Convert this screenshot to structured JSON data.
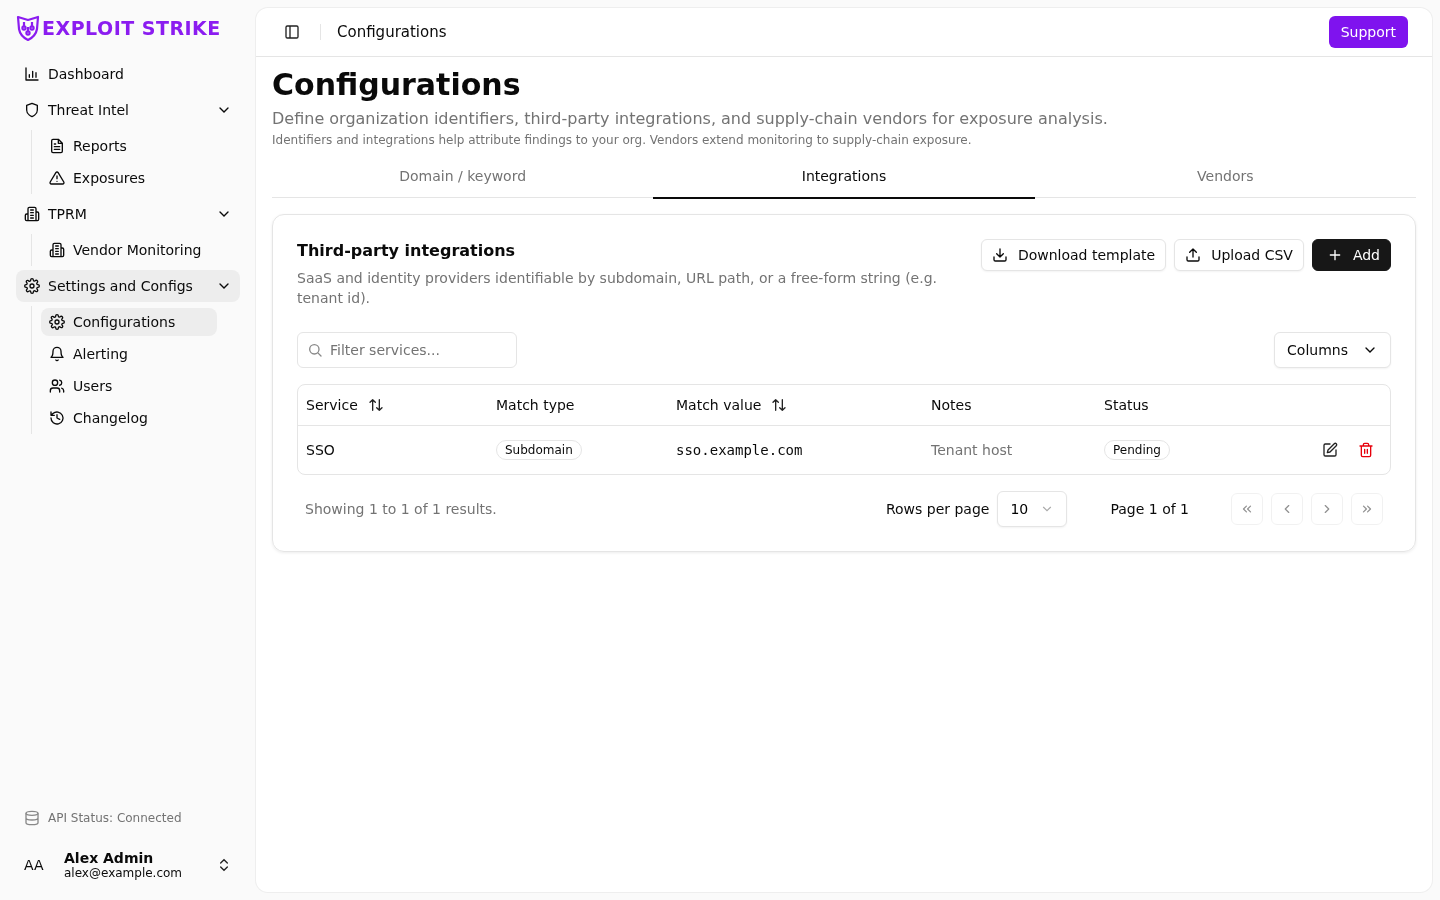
{
  "brand": {
    "name": "EXPLOIT STRIKE"
  },
  "sidebar": {
    "items": [
      {
        "label": "Dashboard",
        "selected": false
      },
      {
        "label": "Threat Intel",
        "selected": false,
        "expanded": true,
        "children": [
          {
            "label": "Reports",
            "selected": false
          },
          {
            "label": "Exposures",
            "selected": false
          }
        ]
      },
      {
        "label": "TPRM",
        "selected": false,
        "expanded": true,
        "children": [
          {
            "label": "Vendor Monitoring",
            "selected": false
          }
        ]
      },
      {
        "label": "Settings and Configs",
        "selected": true,
        "expanded": true,
        "children": [
          {
            "label": "Configurations",
            "selected": true
          },
          {
            "label": "Alerting",
            "selected": false
          },
          {
            "label": "Users",
            "selected": false
          },
          {
            "label": "Changelog",
            "selected": false
          }
        ]
      }
    ],
    "api_status": "API Status: Connected",
    "user": {
      "initials": "AA",
      "name": "Alex Admin",
      "email": "alex@example.com"
    }
  },
  "header": {
    "title": "Configurations",
    "support_button": "Support"
  },
  "page": {
    "title": "Configurations",
    "description": "Define organization identifiers, third-party integrations, and supply-chain vendors for exposure analysis.",
    "note": "Identifiers and integrations help attribute findings to your org. Vendors extend monitoring to supply-chain exposure."
  },
  "tabs": [
    {
      "label": "Domain / keyword",
      "selected": false
    },
    {
      "label": "Integrations",
      "selected": true
    },
    {
      "label": "Vendors",
      "selected": false
    }
  ],
  "card": {
    "title": "Third-party integrations",
    "description": "SaaS and identity providers identifiable by subdomain, URL path, or a free-form string (e.g. tenant id).",
    "buttons": [
      {
        "label": "Download template",
        "kind": "download"
      },
      {
        "label": "Upload CSV",
        "kind": "upload"
      },
      {
        "label": "Add",
        "kind": "add"
      }
    ],
    "search": {
      "placeholder": "Filter services..."
    },
    "columns_button": "Columns",
    "table": {
      "columns": [
        {
          "label": "Service",
          "sortable": true
        },
        {
          "label": "Match type",
          "sortable": false
        },
        {
          "label": "Match value",
          "sortable": true
        },
        {
          "label": "Notes",
          "sortable": false
        },
        {
          "label": "Status",
          "sortable": false
        }
      ],
      "rows": [
        {
          "service": "SSO",
          "match_type": "Subdomain",
          "match_value": "sso.example.com",
          "notes": "Tenant host",
          "status": "Pending"
        }
      ]
    },
    "footer": {
      "summary": "Showing 1 to 1 of 1 results.",
      "rows_per_page_label": "Rows per page",
      "rows_per_page": "10",
      "page_label": "Page 1 of 1",
      "pager": [
        {
          "kind": "first",
          "disabled": true
        },
        {
          "kind": "prev",
          "disabled": true
        },
        {
          "kind": "next",
          "disabled": true
        },
        {
          "kind": "last",
          "disabled": true
        }
      ]
    }
  }
}
